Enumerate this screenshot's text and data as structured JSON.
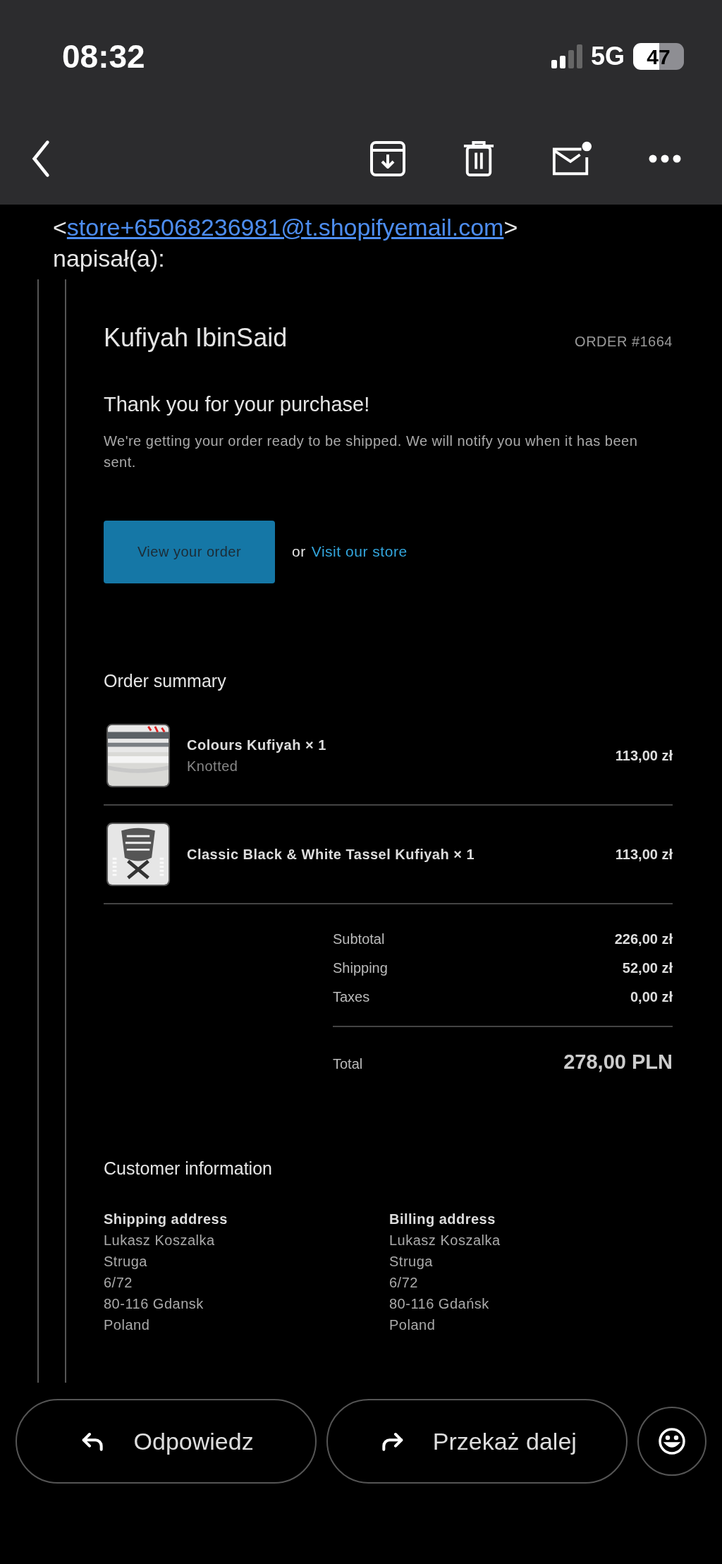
{
  "status_bar": {
    "time": "08:32",
    "network": "5G",
    "battery": "47"
  },
  "sender_line": {
    "open": "<",
    "email": "store+65068236981@t.shopifyemail.com",
    "close": ">",
    "wrote": "napisał(a):"
  },
  "email": {
    "store_name": "Kufiyah IbinSaid",
    "order_number": "ORDER #1664",
    "heading": "Thank you for your purchase!",
    "message": "We're getting your order ready to be shipped. We will notify you when it has been sent.",
    "view_button": "View your order",
    "or": "or",
    "store_link": "Visit our store",
    "summary_title": "Order summary",
    "items": [
      {
        "name": "Colours Kufiyah × 1",
        "variant": "Knotted",
        "price": "113,00 zł",
        "kind": "striped"
      },
      {
        "name": "Classic Black & White Tassel Kufiyah × 1",
        "price": "113,00 zł",
        "kind": "checkered"
      }
    ],
    "totals": [
      {
        "label": "Subtotal",
        "value": "226,00 zł"
      },
      {
        "label": "Shipping",
        "value": "52,00 zł"
      },
      {
        "label": "Taxes",
        "value": "0,00 zł"
      }
    ],
    "total": {
      "label": "Total",
      "value": "278,00 PLN"
    },
    "customer_title": "Customer information",
    "addresses": [
      {
        "title": "Shipping address",
        "lines": [
          "Lukasz Koszalka",
          "Struga",
          "6/72",
          "80-116 Gdansk",
          "Poland"
        ]
      },
      {
        "title": "Billing address",
        "lines": [
          "Lukasz Koszalka",
          "Struga",
          "6/72",
          "80-116 Gdańsk",
          "Poland"
        ]
      }
    ]
  },
  "actions": [
    {
      "kind": "reply",
      "label": "Odpowiedz"
    },
    {
      "kind": "forward",
      "label": "Przekaż dalej"
    }
  ]
}
